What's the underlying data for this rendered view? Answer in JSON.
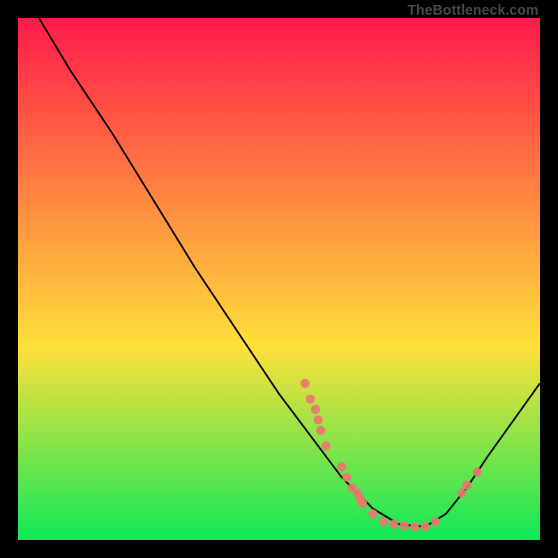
{
  "watermark": "TheBottleneck.com",
  "chart_data": {
    "type": "line",
    "title": "",
    "xlabel": "",
    "ylabel": "",
    "xlim": [
      0,
      100
    ],
    "ylim": [
      0,
      100
    ],
    "gradient_top": "#ff1a4a",
    "gradient_mid": "#ffe03a",
    "gradient_bottom": "#10e858",
    "curve_color": "#000000",
    "points_color": "#e9776f",
    "curve": [
      {
        "x": 4,
        "y": 100
      },
      {
        "x": 10,
        "y": 90
      },
      {
        "x": 18,
        "y": 78
      },
      {
        "x": 26,
        "y": 65
      },
      {
        "x": 34,
        "y": 52
      },
      {
        "x": 42,
        "y": 40
      },
      {
        "x": 50,
        "y": 28
      },
      {
        "x": 56,
        "y": 20
      },
      {
        "x": 62,
        "y": 12
      },
      {
        "x": 68,
        "y": 6
      },
      {
        "x": 73,
        "y": 3
      },
      {
        "x": 78,
        "y": 2.5
      },
      {
        "x": 82,
        "y": 5
      },
      {
        "x": 86,
        "y": 10
      },
      {
        "x": 90,
        "y": 16
      },
      {
        "x": 95,
        "y": 23
      },
      {
        "x": 100,
        "y": 30
      }
    ],
    "points": [
      {
        "x": 55,
        "y": 30
      },
      {
        "x": 56,
        "y": 27
      },
      {
        "x": 57,
        "y": 25
      },
      {
        "x": 57.5,
        "y": 23
      },
      {
        "x": 58,
        "y": 21
      },
      {
        "x": 59,
        "y": 18
      },
      {
        "x": 62,
        "y": 14
      },
      {
        "x": 63,
        "y": 12
      },
      {
        "x": 64,
        "y": 10
      },
      {
        "x": 65,
        "y": 9
      },
      {
        "x": 65.5,
        "y": 8
      },
      {
        "x": 66,
        "y": 7
      },
      {
        "x": 68,
        "y": 5
      },
      {
        "x": 70,
        "y": 3.5
      },
      {
        "x": 72,
        "y": 3
      },
      {
        "x": 74,
        "y": 2.7
      },
      {
        "x": 76,
        "y": 2.5
      },
      {
        "x": 78,
        "y": 2.6
      },
      {
        "x": 80,
        "y": 3.5
      },
      {
        "x": 85,
        "y": 9
      },
      {
        "x": 86,
        "y": 10.5
      },
      {
        "x": 88,
        "y": 13
      }
    ]
  }
}
